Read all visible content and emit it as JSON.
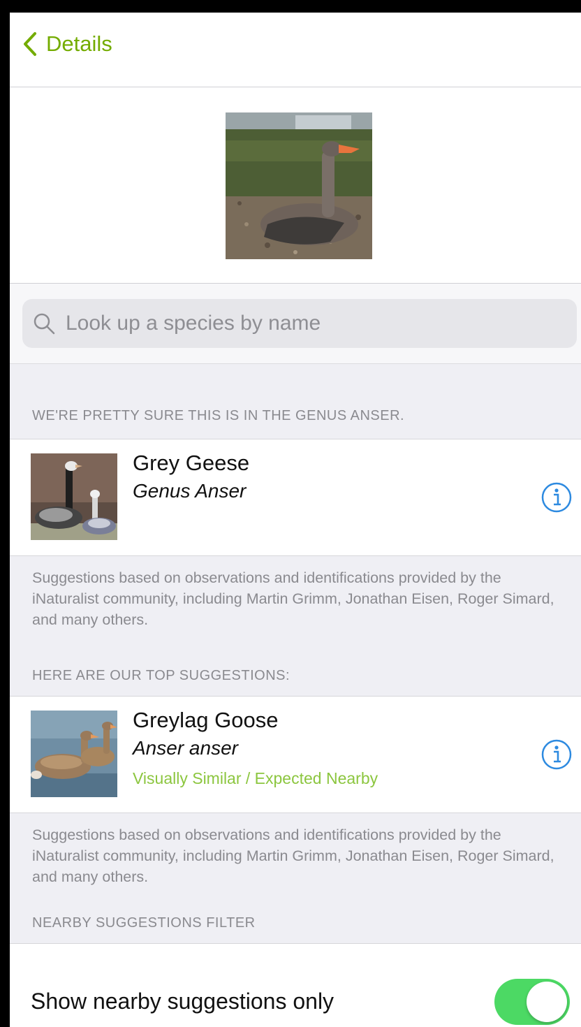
{
  "nav": {
    "back_label": "Details",
    "accent": "#74ac00"
  },
  "search": {
    "placeholder": "Look up a species by name"
  },
  "genus_section": {
    "header": "WE'RE PRETTY SURE THIS IS IN THE GENUS ANSER.",
    "item": {
      "common_name": "Grey Geese",
      "scientific_name": "Genus Anser"
    },
    "footer": "Suggestions based on observations and identifications provided by the iNaturalist community, including Martin Grimm, Jonathan Eisen, Roger Simard, and many others."
  },
  "top_section": {
    "header": "HERE ARE OUR TOP SUGGESTIONS:",
    "item": {
      "common_name": "Greylag Goose",
      "scientific_name": "Anser anser",
      "tag": "Visually Similar / Expected Nearby",
      "tag_color": "#8cc63f"
    },
    "footer": "Suggestions based on observations and identifications provided by the iNaturalist community, including Martin Grimm, Jonathan Eisen, Roger Simard, and many others."
  },
  "filter_section": {
    "header": "NEARBY SUGGESTIONS FILTER",
    "toggle_label": "Show nearby suggestions only",
    "toggle_on": true,
    "toggle_color": "#4cd964"
  },
  "icons": [
    "chevron-left-icon",
    "search-icon",
    "info-icon"
  ]
}
